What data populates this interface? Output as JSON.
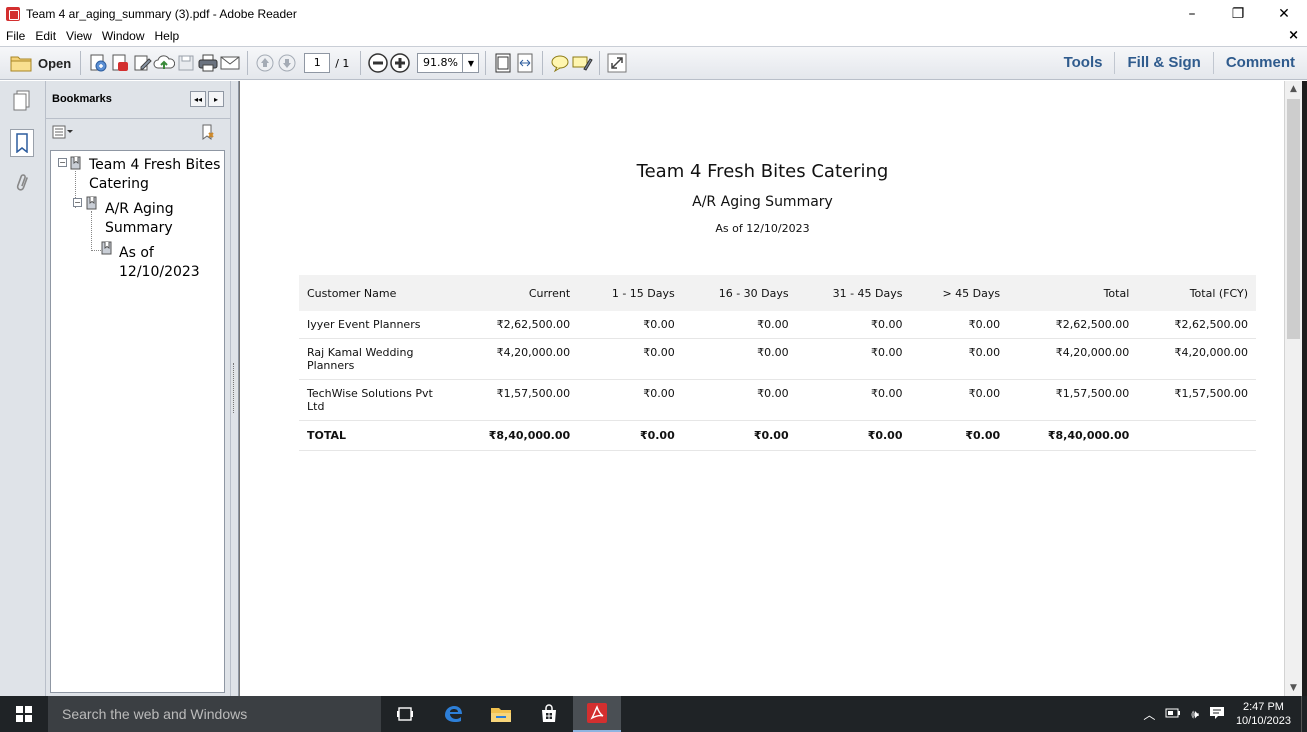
{
  "window": {
    "title": "Team 4 ar_aging_summary (3).pdf - Adobe Reader",
    "minimize": "–",
    "maximize": "❐",
    "close": "✕"
  },
  "menu": {
    "items": [
      "File",
      "Edit",
      "View",
      "Window",
      "Help"
    ],
    "close_doc": "×"
  },
  "toolbar": {
    "open_label": "Open",
    "page_current": "1",
    "page_total": "/ 1",
    "zoom": "91.8%",
    "right_links": [
      "Tools",
      "Fill & Sign",
      "Comment"
    ]
  },
  "bookmarks": {
    "title": "Bookmarks",
    "collapse_btn": "◂◂",
    "expand_btn": "▸",
    "tree": [
      {
        "label_line1": "Team 4 Fresh Bites",
        "label_line2": "Catering"
      },
      {
        "label_line1": "A/R Aging",
        "label_line2": "Summary"
      },
      {
        "label_line1": "As of",
        "label_line2": "12/10/2023"
      }
    ]
  },
  "report": {
    "title": "Team 4 Fresh Bites Catering",
    "subtitle": "A/R Aging Summary",
    "as_of": "As of 12/10/2023",
    "columns": [
      "Customer Name",
      "Current",
      "1 - 15 Days",
      "16 - 30 Days",
      "31 - 45 Days",
      "> 45 Days",
      "Total",
      "Total (FCY)"
    ],
    "rows": [
      [
        "Iyyer Event Planners",
        "₹2,62,500.00",
        "₹0.00",
        "₹0.00",
        "₹0.00",
        "₹0.00",
        "₹2,62,500.00",
        "₹2,62,500.00"
      ],
      [
        "Raj Kamal Wedding Planners",
        "₹4,20,000.00",
        "₹0.00",
        "₹0.00",
        "₹0.00",
        "₹0.00",
        "₹4,20,000.00",
        "₹4,20,000.00"
      ],
      [
        "TechWise Solutions Pvt Ltd",
        "₹1,57,500.00",
        "₹0.00",
        "₹0.00",
        "₹0.00",
        "₹0.00",
        "₹1,57,500.00",
        "₹1,57,500.00"
      ]
    ],
    "total_row": [
      "TOTAL",
      "₹8,40,000.00",
      "₹0.00",
      "₹0.00",
      "₹0.00",
      "₹0.00",
      "₹8,40,000.00",
      ""
    ]
  },
  "taskbar": {
    "search_placeholder": "Search the web and Windows",
    "time": "2:47 PM",
    "date": "10/10/2023"
  },
  "colors": {
    "accent_link": "#2f5b8d",
    "acrobat_red": "#d32f2f"
  }
}
